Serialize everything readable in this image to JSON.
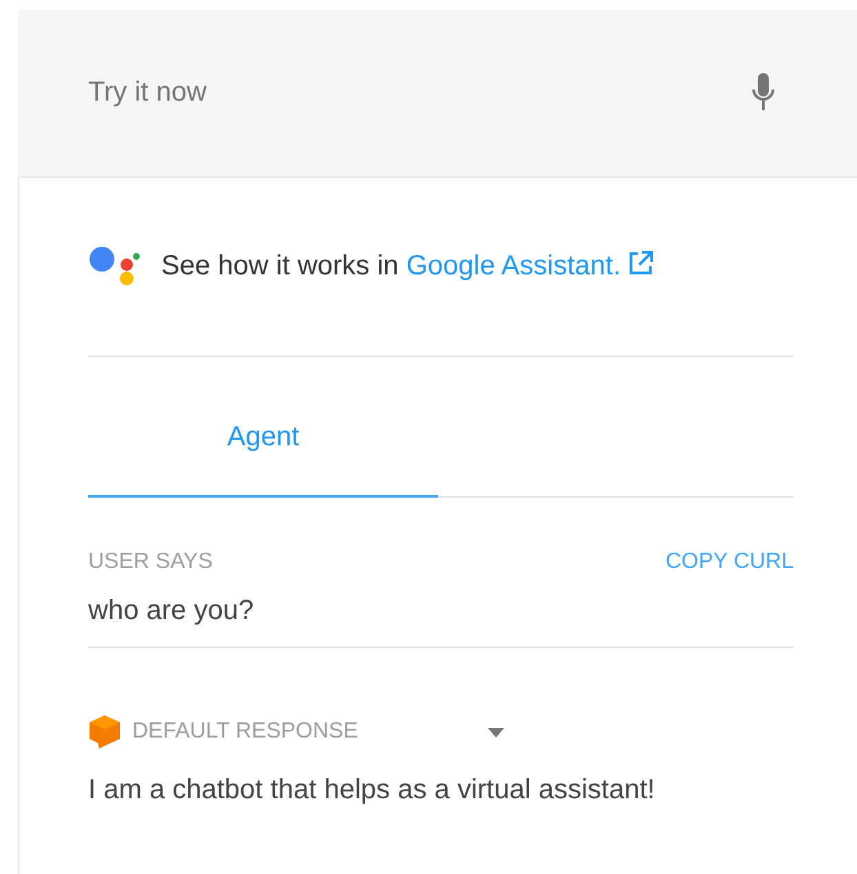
{
  "input": {
    "placeholder": "Try it now"
  },
  "assistant_prompt": {
    "text": "See how it works in ",
    "link": "Google Assistant."
  },
  "tabs": [
    {
      "label": "Agent",
      "selected": true
    }
  ],
  "user_says": {
    "label": "USER SAYS",
    "action": "COPY CURL",
    "query": "who are you?"
  },
  "response": {
    "label": "DEFAULT RESPONSE",
    "text": "I am a chatbot that helps as a virtual assistant!"
  }
}
